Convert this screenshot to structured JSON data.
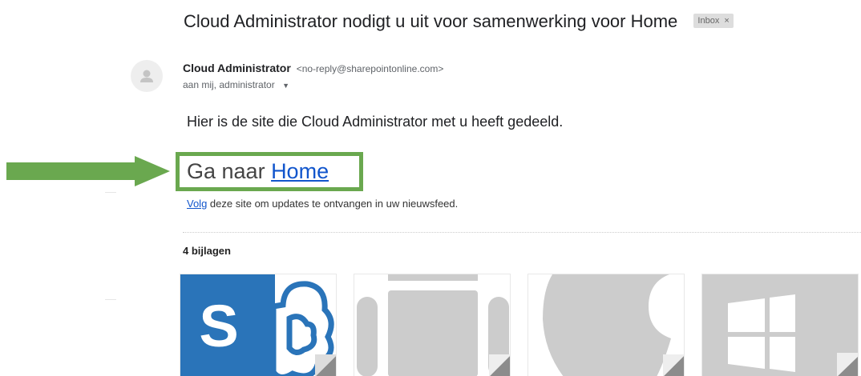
{
  "email": {
    "subject": "Cloud Administrator nodigt u uit voor samenwerking voor Home",
    "label": "Inbox",
    "label_close": "×",
    "sender_name": "Cloud Administrator",
    "sender_email": "<no-reply@sharepointonline.com>",
    "recipients": "aan mij, administrator",
    "recipients_caret": "▼",
    "body_intro": "Hier is de site die Cloud Administrator met u heeft gedeeld.",
    "goto_prefix": "Ga naar ",
    "goto_link": "Home",
    "follow_link": "Volg",
    "follow_rest": " deze site om updates te ontvangen in uw nieuwsfeed."
  },
  "attachments": {
    "header": "4 bijlagen",
    "items": [
      {
        "icon": "sharepoint-icon",
        "color": "#2a74b9"
      },
      {
        "icon": "android-icon",
        "color": "#cccccc"
      },
      {
        "icon": "apple-icon",
        "color": "#cccccc"
      },
      {
        "icon": "windows-icon",
        "color": "#cccccc"
      }
    ]
  },
  "colors": {
    "highlight": "#6aa84f",
    "link": "#1155cc",
    "arrow": "#6aa84f"
  }
}
